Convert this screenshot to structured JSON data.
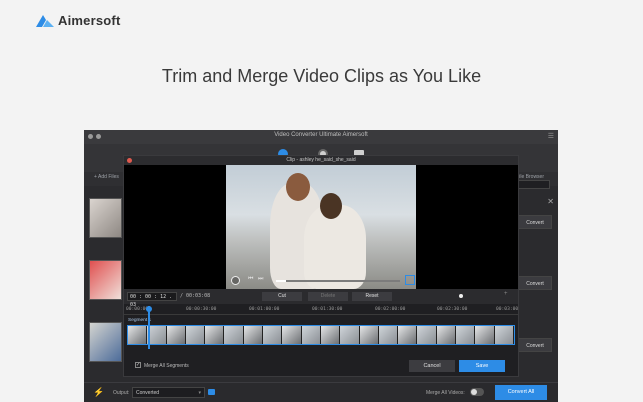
{
  "brand": {
    "name": "Aimersoft",
    "accent": "#2d8ce6"
  },
  "headline": "Trim and Merge Video Clips as You Like",
  "window": {
    "title": "Video Converter Ultimate Aimersoft"
  },
  "filebar": {
    "add_files": "+ Add Files",
    "right_label": "ile Browser"
  },
  "rows": {
    "convert_label": "Convert"
  },
  "bottom": {
    "output_label": "Output:",
    "output_value": "Converted",
    "merge_all_videos": "Merge All Videos:",
    "convert_all": "Convert All"
  },
  "clip": {
    "title": "Clip - ashley he_said_she_said",
    "time_value": "00 : 00 : 12 . 03",
    "duration": "/ 00:03:08",
    "cut": "Cut",
    "delete": "Delete",
    "reset": "Reset",
    "ruler": [
      "00:00:00",
      "00:00:30:00",
      "00:01:00:00",
      "00:01:30:00",
      "00:02:00:00",
      "00:02:30:00",
      "00:03:00"
    ],
    "segment": "Segment 1",
    "merge_all_segments": "Merge All Segments",
    "cancel": "Cancel",
    "save": "Save"
  }
}
